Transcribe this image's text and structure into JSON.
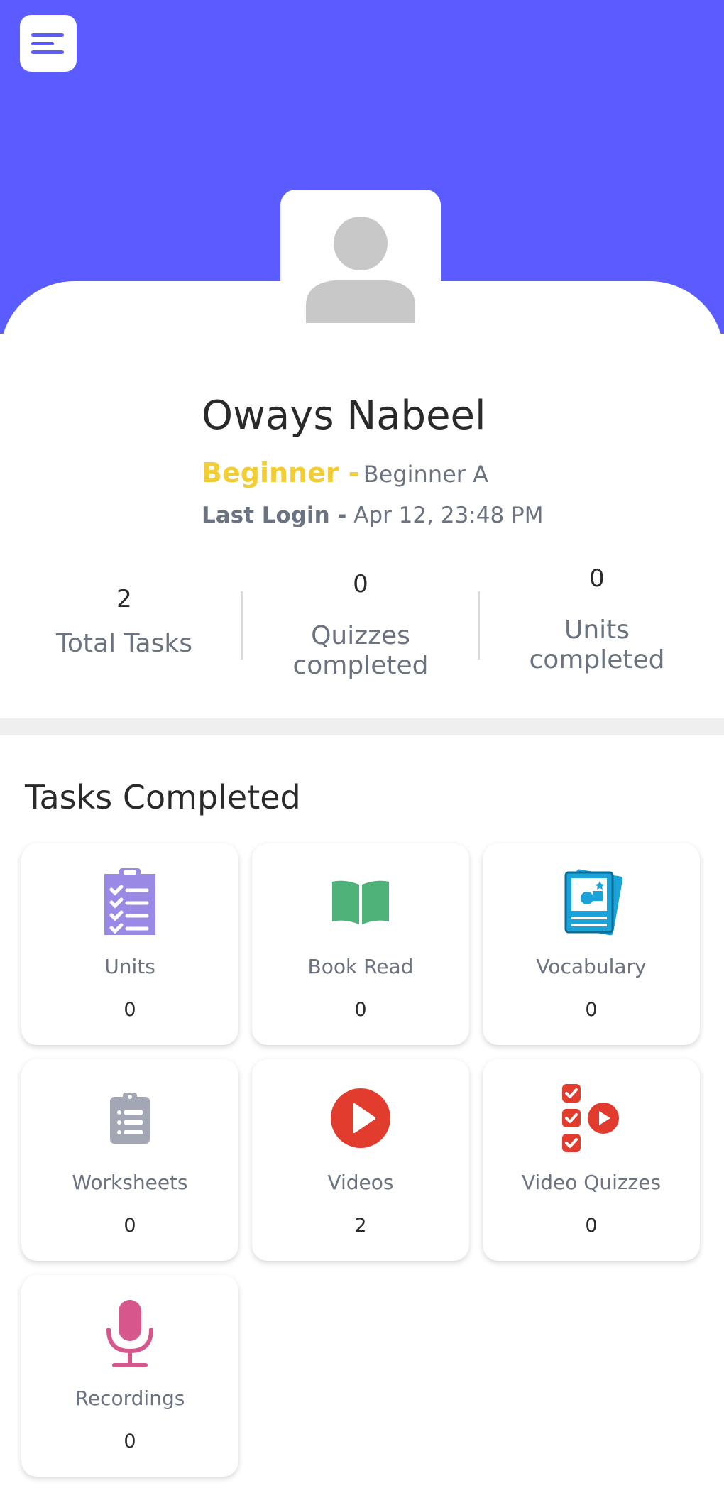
{
  "profile": {
    "name": "Oways Nabeel",
    "level": "Beginner -",
    "sublevel": "Beginner A",
    "last_login_label": "Last Login -",
    "last_login_value": "Apr 12, 23:48 PM"
  },
  "stats": [
    {
      "value": "2",
      "label": "Total Tasks"
    },
    {
      "value": "0",
      "label_line1": "Quizzes",
      "label_line2": "completed"
    },
    {
      "value": "0",
      "label_line1": "Units",
      "label_line2": "completed"
    }
  ],
  "tasks_section": {
    "title": "Tasks Completed",
    "tiles": [
      {
        "label": "Units",
        "value": "0",
        "icon": "clipboard-checklist-icon"
      },
      {
        "label": "Book Read",
        "value": "0",
        "icon": "open-book-icon"
      },
      {
        "label": "Vocabulary",
        "value": "0",
        "icon": "flashcards-icon"
      },
      {
        "label": "Worksheets",
        "value": "0",
        "icon": "clipboard-list-icon"
      },
      {
        "label": "Videos",
        "value": "2",
        "icon": "play-circle-icon"
      },
      {
        "label": "Video Quizzes",
        "value": "0",
        "icon": "checklist-play-icon"
      },
      {
        "label": "Recordings",
        "value": "0",
        "icon": "microphone-icon"
      }
    ]
  },
  "colors": {
    "brand": "#5a5cff",
    "level": "#f2cd33",
    "muted_text": "#6b7280"
  }
}
